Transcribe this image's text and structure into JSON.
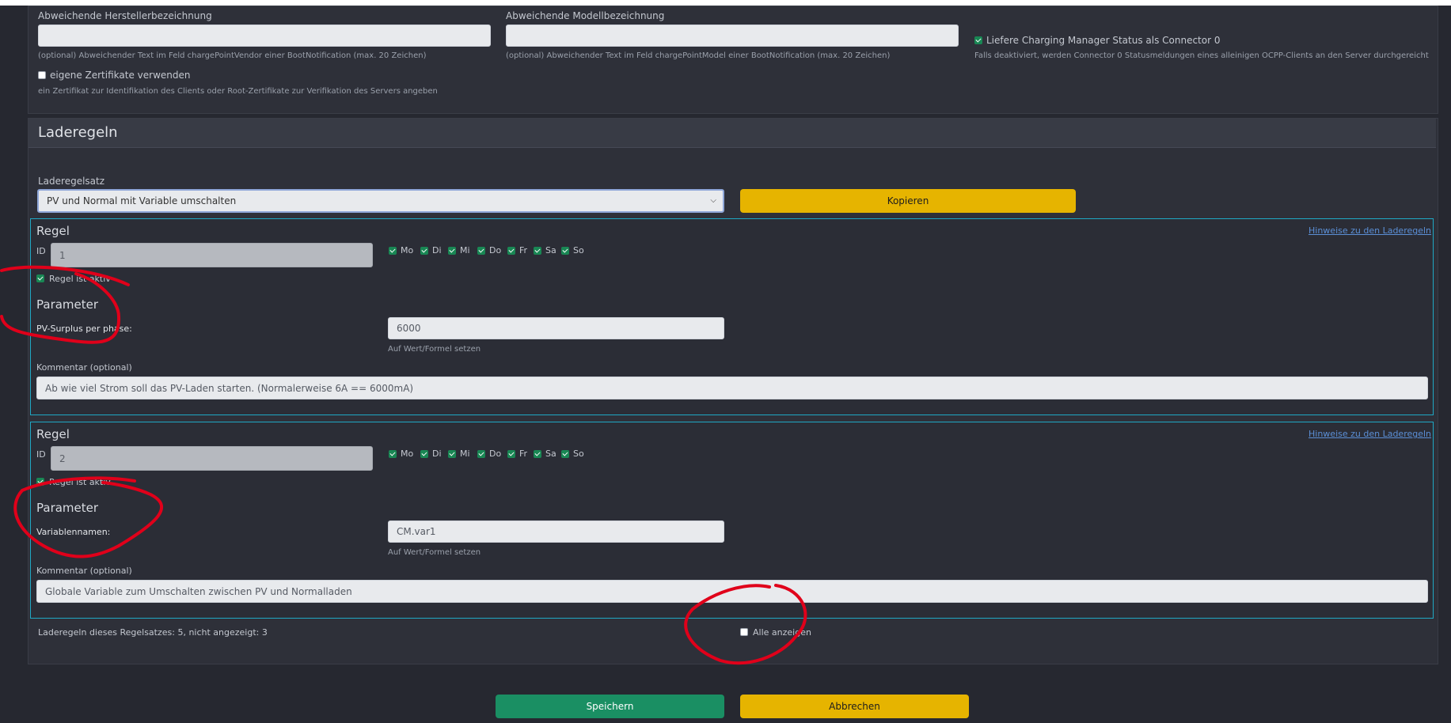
{
  "top_section": {
    "vendor_label": "Abweichende Herstellerbezeichnung",
    "vendor_value": "",
    "vendor_help": "(optional) Abweichender Text im Feld chargePointVendor einer BootNotification (max. 20 Zeichen)",
    "model_label": "Abweichende Modellbezeichnung",
    "model_value": "",
    "model_help": "(optional) Abweichender Text im Feld chargePointModel einer BootNotification (max. 20 Zeichen)",
    "cm_status_label": "Liefere Charging Manager Status als Connector 0",
    "cm_status_help": "Falls deaktiviert, werden Connector 0 Statusmeldungen eines alleinigen OCPP-Clients an den Server durchgereicht",
    "certs_label": "eigene Zertifikate verwenden",
    "certs_help": "ein Zertifikat zur Identifikation des Clients oder Root-Zertifikate zur Verifikation des Servers angeben"
  },
  "laderegeln": {
    "title": "Laderegeln",
    "ruleset_label": "Laderegelsatz",
    "ruleset_selected": "PV und Normal mit Variable umschalten",
    "copy_button": "Kopieren",
    "rules": [
      {
        "title": "Regel",
        "hint_link": "Hinweise zu den Laderegeln",
        "id_label": "ID",
        "id_value": "1",
        "days": [
          "Mo",
          "Di",
          "Mi",
          "Do",
          "Fr",
          "Sa",
          "So"
        ],
        "active_label": "Regel ist aktiv",
        "param_title": "Parameter",
        "param_label": "PV-Surplus per phase:",
        "param_value": "6000",
        "param_help": "Auf Wert/Formel setzen",
        "comment_label": "Kommentar (optional)",
        "comment_value": "Ab wie viel Strom soll das PV-Laden starten. (Normalerweise 6A == 6000mA)"
      },
      {
        "title": "Regel",
        "hint_link": "Hinweise zu den Laderegeln",
        "id_label": "ID",
        "id_value": "2",
        "days": [
          "Mo",
          "Di",
          "Mi",
          "Do",
          "Fr",
          "Sa",
          "So"
        ],
        "active_label": "Regel ist aktiv",
        "param_title": "Parameter",
        "param_label": "Variablennamen:",
        "param_value": "CM.var1",
        "param_help": "Auf Wert/Formel setzen",
        "comment_label": "Kommentar (optional)",
        "comment_value": "Globale Variable zum Umschalten zwischen PV und Normalladen"
      }
    ],
    "summary": "Laderegeln dieses Regelsatzes: 5, nicht angezeigt: 3",
    "show_all_label": "Alle anzeigen"
  },
  "footer": {
    "save_button": "Speichern",
    "cancel_button": "Abbrechen"
  },
  "colors": {
    "background": "#262830",
    "panel": "#2e3039",
    "accent_yellow": "#e6b400",
    "accent_green": "#1a8f63",
    "rule_border": "#1fa8c4",
    "annotation_red": "#e0001a"
  }
}
